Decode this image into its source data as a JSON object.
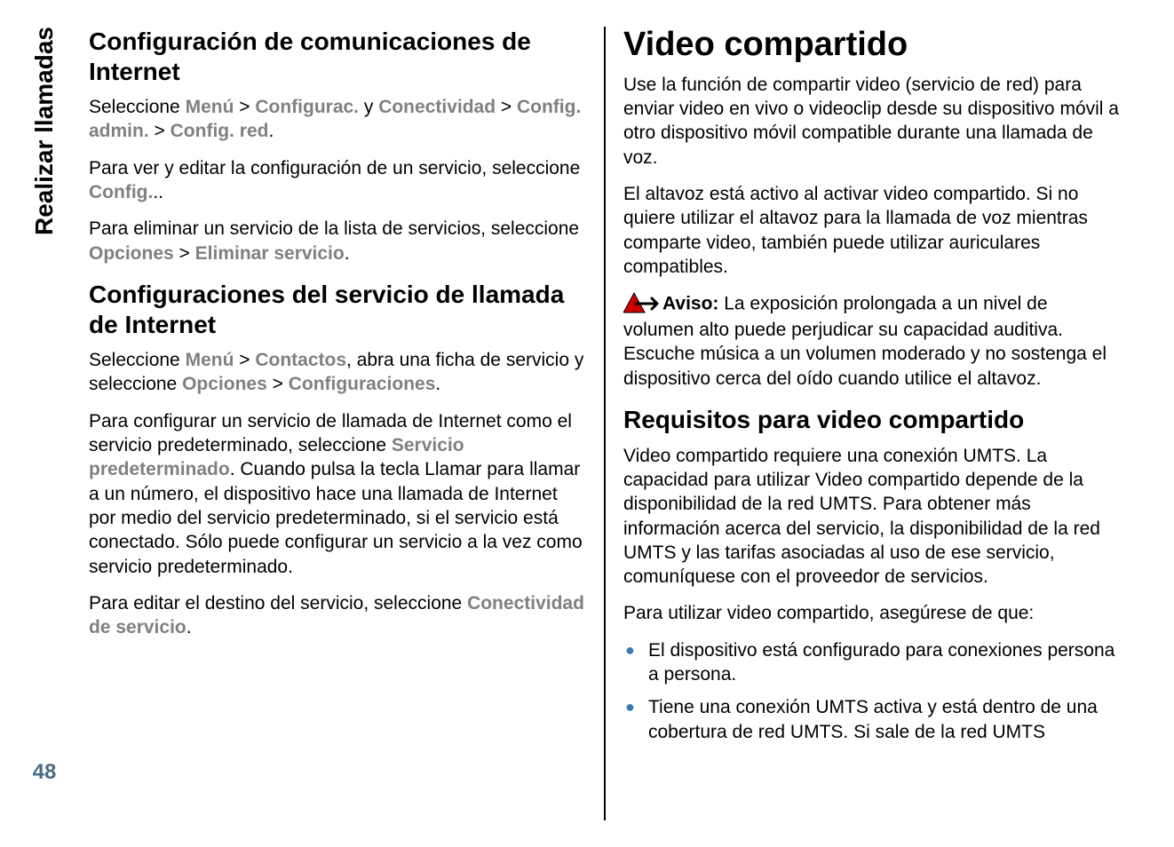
{
  "side": {
    "sectionLabel": "Realizar llamadas",
    "pageNumber": "48"
  },
  "left": {
    "h1": "Configuración de comunicaciones de Internet",
    "p1a": "Seleccione ",
    "p1_menu": "Menú",
    "sep_gt": " > ",
    "p1_configurac": "Configurac.",
    "p1_y": " y ",
    "p1_conectividad": "Conectividad",
    "p1_config_admin": "Config. admin.",
    "p1_config_red": "Config. red",
    "dot": ".",
    "p2a": "Para ver y editar la configuración de un servicio, seleccione ",
    "p2_config": "Config.",
    "doubledot": "..",
    "p3a": "Para eliminar un servicio de la lista de servicios, seleccione ",
    "p3_opciones": "Opciones",
    "p3_eliminar": "Eliminar servicio",
    "h2": "Configuraciones del servicio de llamada de Internet",
    "p4a": "Seleccione ",
    "p4_menu": "Menú",
    "p4_contactos": "Contactos",
    "p4b": ", abra una ficha de servicio y seleccione ",
    "p4_opciones": "Opciones",
    "p4_configuraciones": "Configuraciones",
    "p5a": "Para configurar un servicio de llamada de Internet como el servicio predeterminado, seleccione ",
    "p5_servicio_pred": "Servicio predeterminado",
    "p5b": ". Cuando pulsa la tecla Llamar para llamar a un número, el dispositivo hace una llamada de Internet por medio del servicio predeterminado, si el servicio está conectado. Sólo puede configurar un servicio a la vez como servicio predeterminado.",
    "p6a": "Para editar el destino del servicio, seleccione ",
    "p6_conectividad_servicio": "Conectividad de servicio"
  },
  "right": {
    "h1": "Video compartido",
    "p1": "Use la función de compartir video (servicio de red) para enviar video en vivo o videoclip desde su dispositivo móvil a otro dispositivo móvil compatible durante una llamada de voz.",
    "p2": "El altavoz está activo al activar video compartido. Si no quiere utilizar el altavoz para la llamada de voz mientras comparte video, también puede utilizar auriculares compatibles.",
    "warn_label": "Aviso:  ",
    "warn_text": "La exposición prolongada a un nivel de volumen alto puede perjudicar su capacidad auditiva. Escuche música a un volumen moderado y no sostenga el dispositivo cerca del oído cuando utilice el altavoz.",
    "h2": "Requisitos para video compartido",
    "p3": "Video compartido requiere una conexión UMTS. La capacidad para utilizar Video compartido depende de la disponibilidad de la red UMTS. Para obtener más información acerca del servicio, la disponibilidad de la red UMTS y las tarifas asociadas al uso de ese servicio, comuníquese con el proveedor de servicios.",
    "p4": "Para utilizar video compartido, asegúrese de que:",
    "li1": "El dispositivo está configurado para conexiones persona a persona.",
    "li2": "Tiene una conexión UMTS activa y está dentro de una cobertura de red UMTS. Si sale de la red UMTS"
  }
}
